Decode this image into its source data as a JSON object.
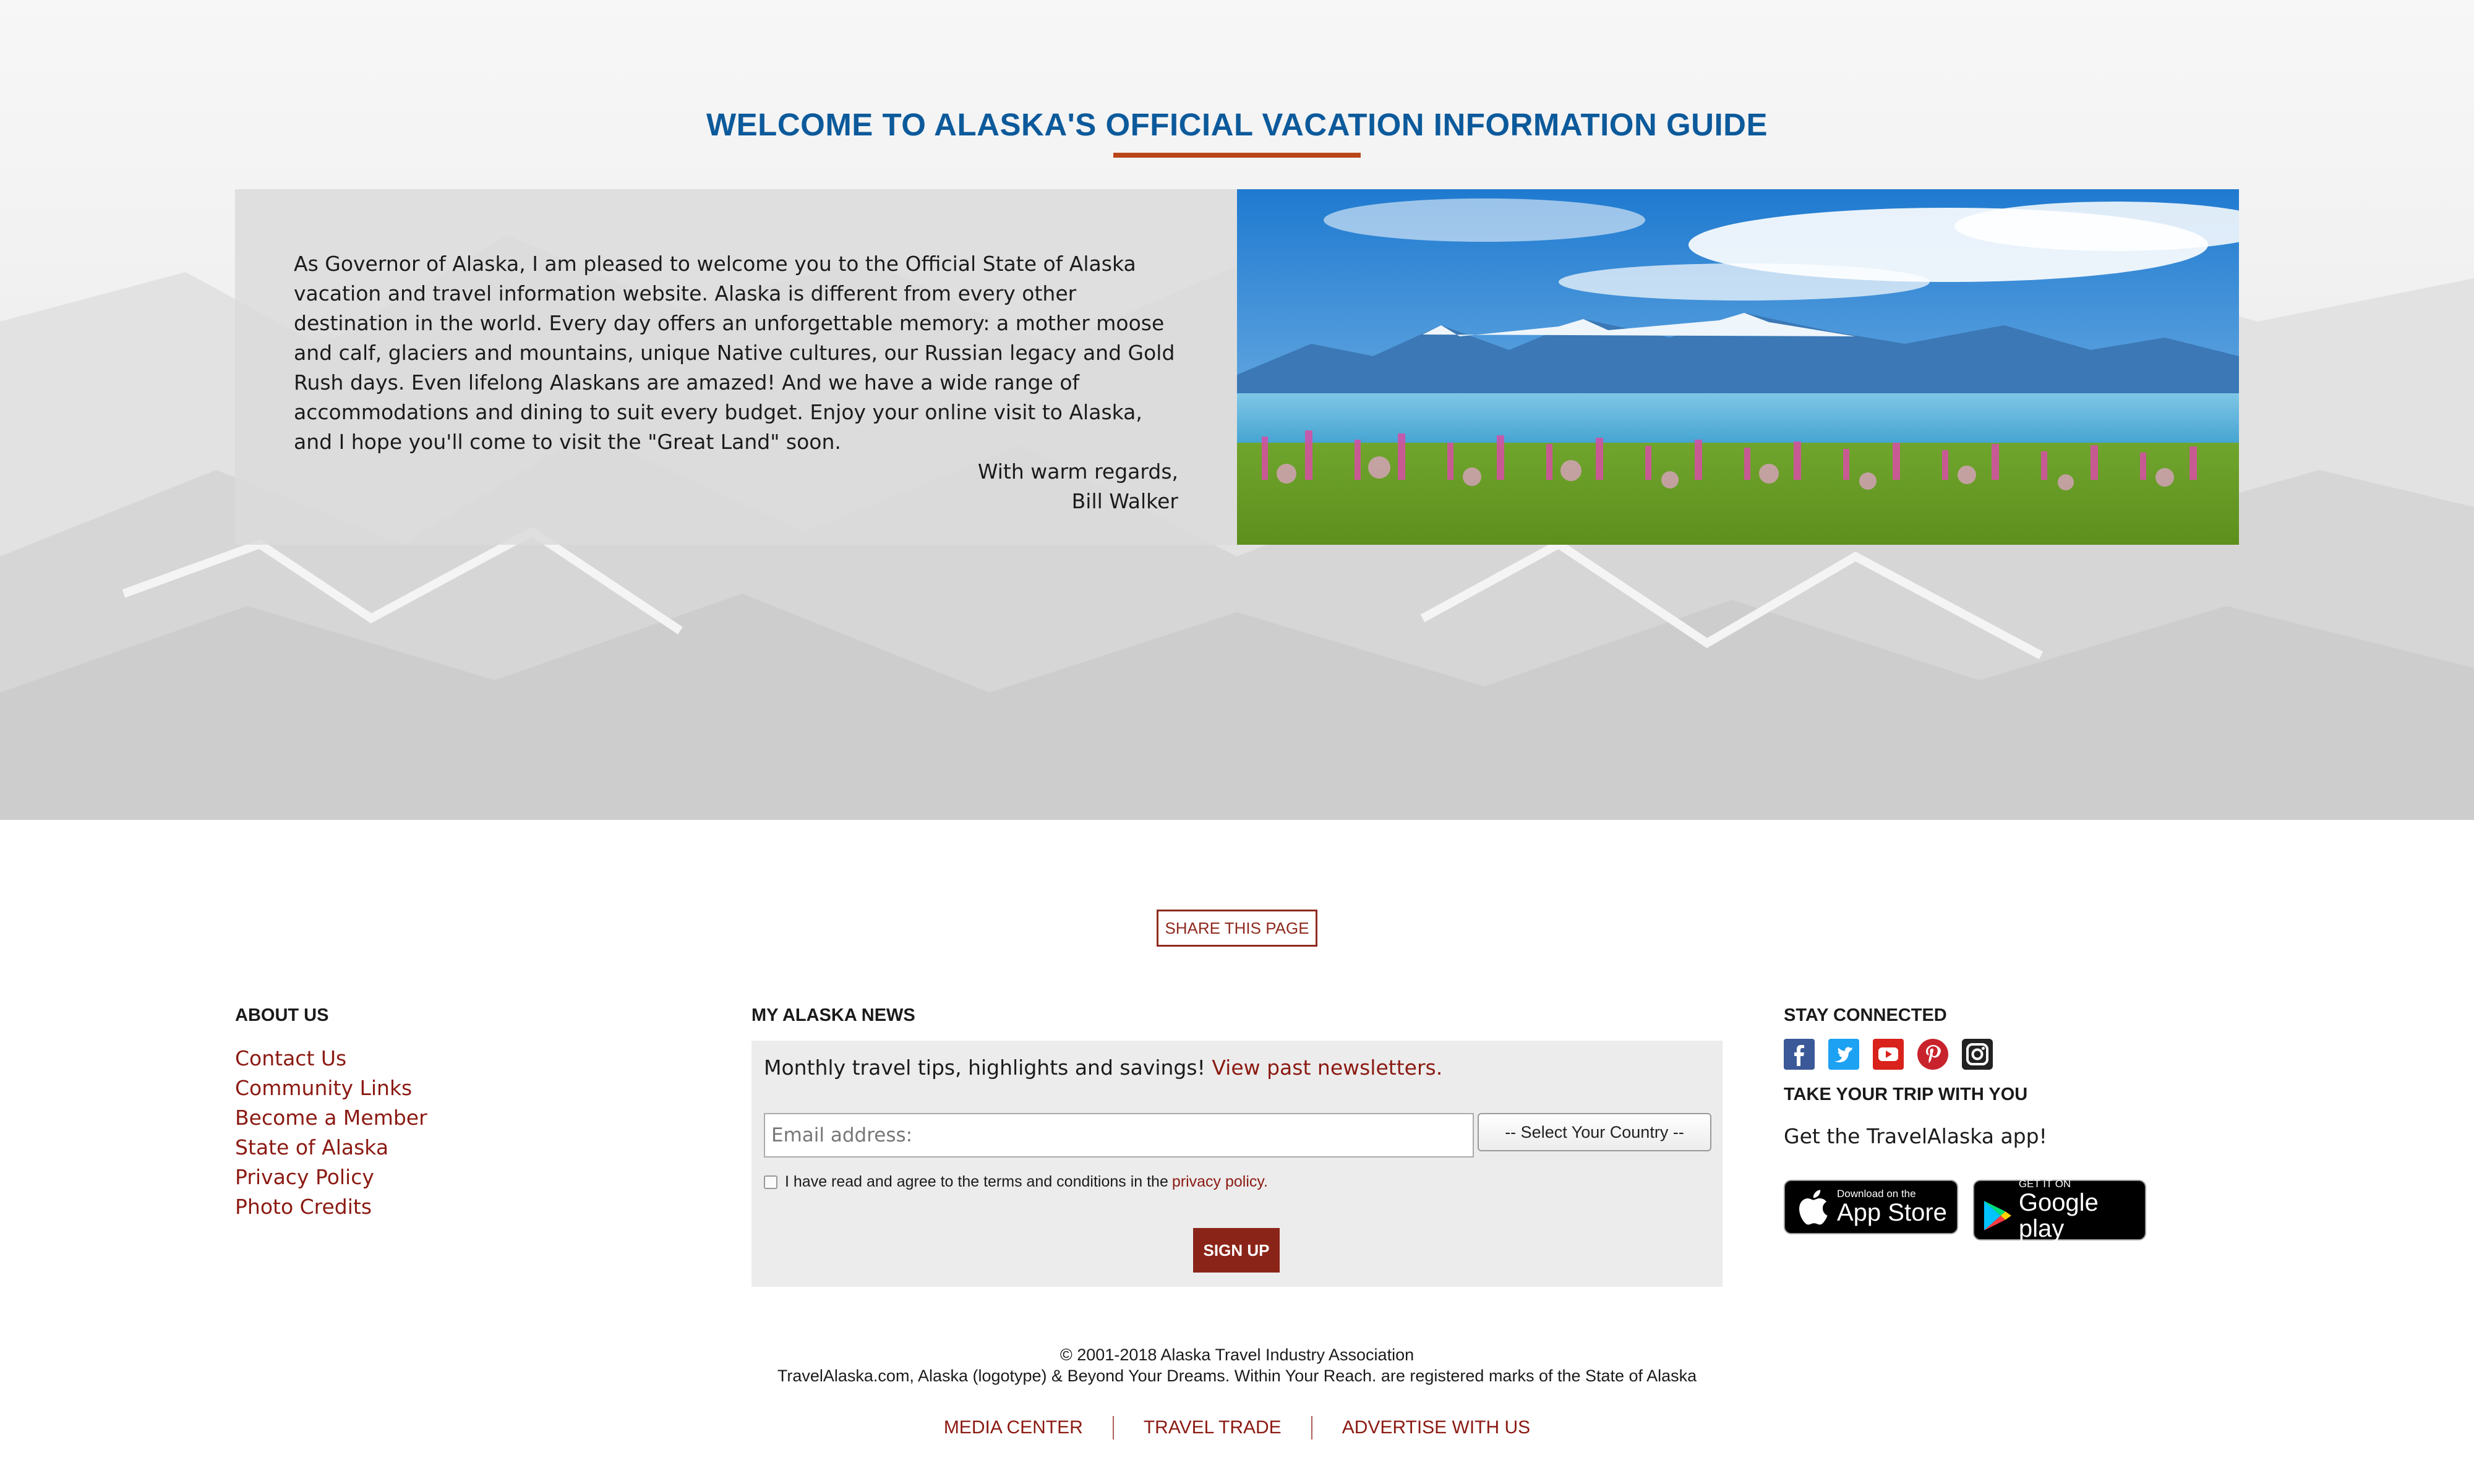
{
  "welcome": {
    "title": "WELCOME TO ALASKA'S OFFICIAL VACATION INFORMATION GUIDE",
    "paragraph": "As Governor of Alaska, I am pleased to welcome you to the Official State of Alaska vacation and travel information website. Alaska is different from every other destination in the world. Every day offers an unforgettable memory: a mother moose and calf, glaciers and mountains, unique Native cultures, our Russian legacy and Gold Rush days. Even lifelong Alaskans are amazed! And we have a wide range of accommodations and dining to suit every budget. Enjoy your online visit to Alaska, and I hope you'll come to visit the \"Great Land\" soon.",
    "closing": "With warm regards,",
    "signature": "Bill Walker"
  },
  "share": {
    "label": "SHARE THIS PAGE"
  },
  "about": {
    "heading": "ABOUT US",
    "links": [
      "Contact Us",
      "Community Links",
      "Become a Member",
      "State of Alaska",
      "Privacy Policy",
      "Photo Credits"
    ]
  },
  "news": {
    "heading": "MY ALASKA NEWS",
    "intro": "Monthly travel tips, highlights and savings!",
    "intro_link": "View past newsletters.",
    "email_placeholder": "Email address:",
    "country_selected": "-- Select Your Country --",
    "agree_text": "I have read and agree to the terms and conditions in the",
    "agree_link": "privacy policy.",
    "signup_label": "SIGN UP"
  },
  "connect": {
    "heading": "STAY CONNECTED",
    "icons": [
      "facebook-icon",
      "twitter-icon",
      "youtube-icon",
      "pinterest-icon",
      "instagram-icon"
    ],
    "trip_heading": "TAKE YOUR TRIP WITH YOU",
    "app_text": "Get the TravelAlaska app!",
    "app_store": {
      "small": "Download on the",
      "big": "App Store"
    },
    "google_play": {
      "small": "GET IT ON",
      "big": "Google play"
    }
  },
  "legal": {
    "copyright": "© 2001-2018 Alaska Travel Industry Association",
    "marks": "TravelAlaska.com, Alaska (logotype) & Beyond Your Dreams. Within Your Reach. are registered marks of the State of Alaska"
  },
  "bottom_links": [
    "MEDIA CENTER",
    "TRAVEL TRADE",
    "ADVERTISE WITH US"
  ],
  "colors": {
    "title_blue": "#0c5a9b",
    "accent_orange": "#b9461a",
    "link_red": "#8b1a12",
    "button_red": "#8b2418"
  }
}
